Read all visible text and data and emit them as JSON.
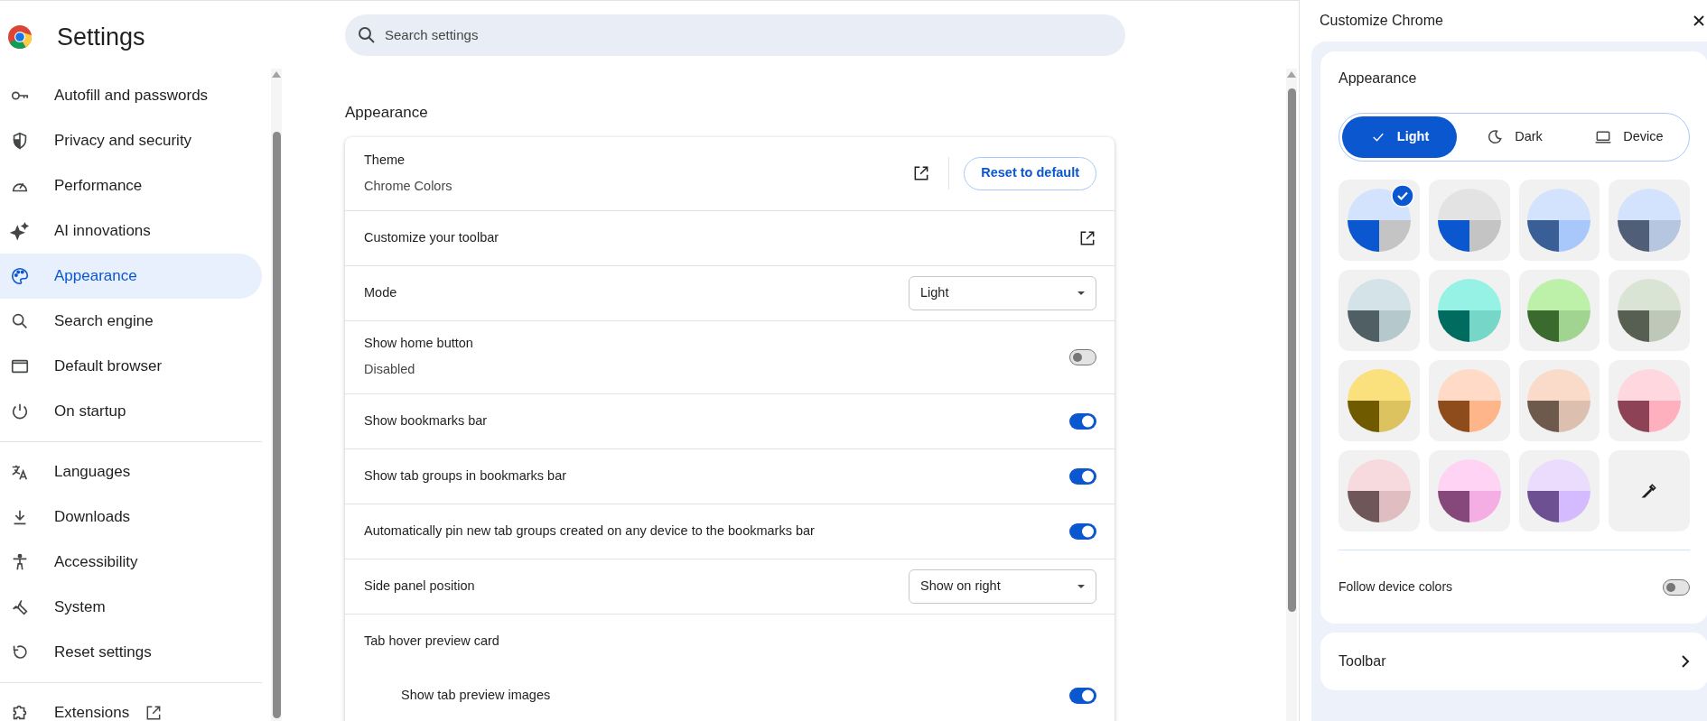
{
  "sidebar": {
    "title": "Settings",
    "groups": [
      [
        {
          "label": "Autofill and passwords",
          "kind": "link",
          "selected": false
        },
        {
          "label": "Privacy and security",
          "kind": "link",
          "selected": false
        },
        {
          "label": "Performance",
          "kind": "link",
          "selected": false
        },
        {
          "label": "AI innovations",
          "kind": "link",
          "selected": false
        },
        {
          "label": "Appearance",
          "kind": "link",
          "selected": true
        },
        {
          "label": "Search engine",
          "kind": "link",
          "selected": false
        },
        {
          "label": "Default browser",
          "kind": "link",
          "selected": false
        },
        {
          "label": "On startup",
          "kind": "link",
          "selected": false
        }
      ],
      [
        {
          "label": "Languages",
          "kind": "link",
          "selected": false
        },
        {
          "label": "Downloads",
          "kind": "link",
          "selected": false
        },
        {
          "label": "Accessibility",
          "kind": "link",
          "selected": false
        },
        {
          "label": "System",
          "kind": "link",
          "selected": false
        },
        {
          "label": "Reset settings",
          "kind": "link",
          "selected": false
        }
      ],
      [
        {
          "label": "Extensions",
          "kind": "external",
          "selected": false
        }
      ]
    ]
  },
  "search": {
    "placeholder": "Search settings"
  },
  "section": {
    "title": "Appearance",
    "rows": [
      {
        "kind": "theme",
        "label": "Theme",
        "sublabel": "Chrome Colors",
        "button": "Reset to default"
      },
      {
        "kind": "link",
        "label": "Customize your toolbar"
      },
      {
        "kind": "select",
        "label": "Mode",
        "value": "Light"
      },
      {
        "kind": "toggle",
        "label": "Show home button",
        "sublabel": "Disabled",
        "on": false
      },
      {
        "kind": "toggle",
        "label": "Show bookmarks bar",
        "on": true
      },
      {
        "kind": "toggle",
        "label": "Show tab groups in bookmarks bar",
        "on": true
      },
      {
        "kind": "toggle",
        "label": "Automatically pin new tab groups created on any device to the bookmarks bar",
        "on": true
      },
      {
        "kind": "select",
        "label": "Side panel position",
        "value": "Show on right"
      },
      {
        "kind": "heading",
        "label": "Tab hover preview card",
        "children": [
          {
            "kind": "toggle",
            "label": "Show tab preview images",
            "on": true
          }
        ]
      }
    ]
  },
  "panel": {
    "title": "Customize Chrome",
    "card": {
      "title": "Appearance",
      "modes": [
        {
          "label": "Light",
          "selected": true
        },
        {
          "label": "Dark",
          "selected": false
        },
        {
          "label": "Device",
          "selected": false
        }
      ],
      "swatches": [
        {
          "kind": "color",
          "selected": true,
          "parts": [
            {
              "color": "#d3e3fd"
            },
            {
              "color": "#0b57d0"
            },
            {
              "color": "#c4c4c4"
            }
          ]
        },
        {
          "kind": "color",
          "selected": false,
          "parts": [
            {
              "color": "#e3e3e3"
            },
            {
              "color": "#0b57d0"
            },
            {
              "color": "#c4c4c4"
            }
          ]
        },
        {
          "kind": "color",
          "selected": false,
          "parts": [
            {
              "color": "#d3e3fd"
            },
            {
              "color": "#3a5e96"
            },
            {
              "color": "#a8c7fa"
            }
          ]
        },
        {
          "kind": "color",
          "selected": false,
          "parts": [
            {
              "color": "#d3e3fd"
            },
            {
              "color": "#515e78"
            },
            {
              "color": "#b7c6e0"
            }
          ]
        },
        {
          "kind": "color",
          "selected": false,
          "parts": [
            {
              "color": "#d4e3e7"
            },
            {
              "color": "#4f5f63"
            },
            {
              "color": "#b5c9cc"
            }
          ]
        },
        {
          "kind": "color",
          "selected": false,
          "parts": [
            {
              "color": "#96f2e4"
            },
            {
              "color": "#006b5f"
            },
            {
              "color": "#76d6c8"
            }
          ]
        },
        {
          "kind": "color",
          "selected": false,
          "parts": [
            {
              "color": "#bdf0a8"
            },
            {
              "color": "#3b6a2f"
            },
            {
              "color": "#a1d391"
            }
          ]
        },
        {
          "kind": "color",
          "selected": false,
          "parts": [
            {
              "color": "#dae4d5"
            },
            {
              "color": "#565f52"
            },
            {
              "color": "#bec8b9"
            }
          ]
        },
        {
          "kind": "color",
          "selected": false,
          "parts": [
            {
              "color": "#fbe07e"
            },
            {
              "color": "#6f5a00"
            },
            {
              "color": "#dcc35f"
            }
          ]
        },
        {
          "kind": "color",
          "selected": false,
          "parts": [
            {
              "color": "#ffdbc7"
            },
            {
              "color": "#8e4c1c"
            },
            {
              "color": "#ffb58a"
            }
          ]
        },
        {
          "kind": "color",
          "selected": false,
          "parts": [
            {
              "color": "#fadbca"
            },
            {
              "color": "#6e5a4c"
            },
            {
              "color": "#dcbfae"
            }
          ]
        },
        {
          "kind": "color",
          "selected": false,
          "parts": [
            {
              "color": "#ffd7df"
            },
            {
              "color": "#8d4255"
            },
            {
              "color": "#ffb0bf"
            }
          ]
        },
        {
          "kind": "color",
          "selected": false,
          "parts": [
            {
              "color": "#f7dade"
            },
            {
              "color": "#6f5658"
            },
            {
              "color": "#dfbdc0"
            }
          ]
        },
        {
          "kind": "color",
          "selected": false,
          "parts": [
            {
              "color": "#fed3f4"
            },
            {
              "color": "#86487a"
            },
            {
              "color": "#f5aee4"
            }
          ]
        },
        {
          "kind": "color",
          "selected": false,
          "parts": [
            {
              "color": "#ebdcfd"
            },
            {
              "color": "#6c5092"
            },
            {
              "color": "#d4bbff"
            }
          ]
        },
        {
          "kind": "custom",
          "selected": false
        }
      ],
      "follow": {
        "label": "Follow device colors",
        "on": false
      }
    },
    "toolbar": {
      "label": "Toolbar"
    }
  }
}
